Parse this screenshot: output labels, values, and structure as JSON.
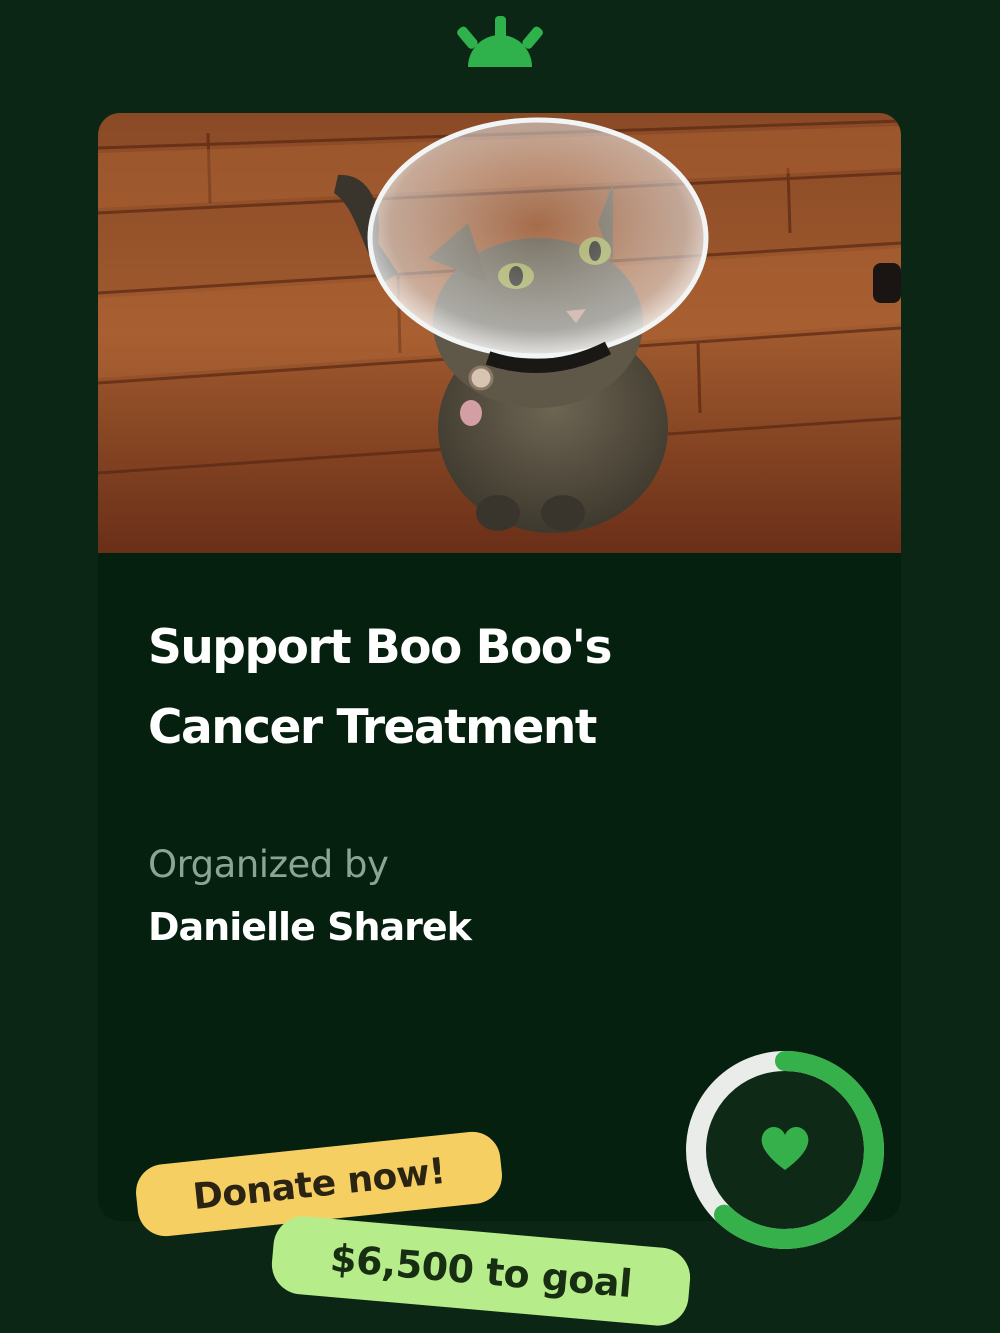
{
  "campaign": {
    "title_line1": "Support Boo Boo's",
    "title_line2": "Cancer Treatment",
    "organizer_label": "Organized by",
    "organizer_name": "Danielle Sharek",
    "photo_subject": "tabby-cat-with-cone-collar"
  },
  "actions": {
    "donate_label": "Donate now!",
    "goal_text": "$6,500 to goal"
  },
  "progress": {
    "fraction": 0.62,
    "icon": "heart-icon"
  },
  "colors": {
    "background": "#0c2616",
    "card": "#06200f",
    "brand_green": "#35b04a",
    "ring_track": "#e9ece9",
    "donate_pill": "#f6cf63",
    "goal_pill": "#b7ec8a"
  }
}
